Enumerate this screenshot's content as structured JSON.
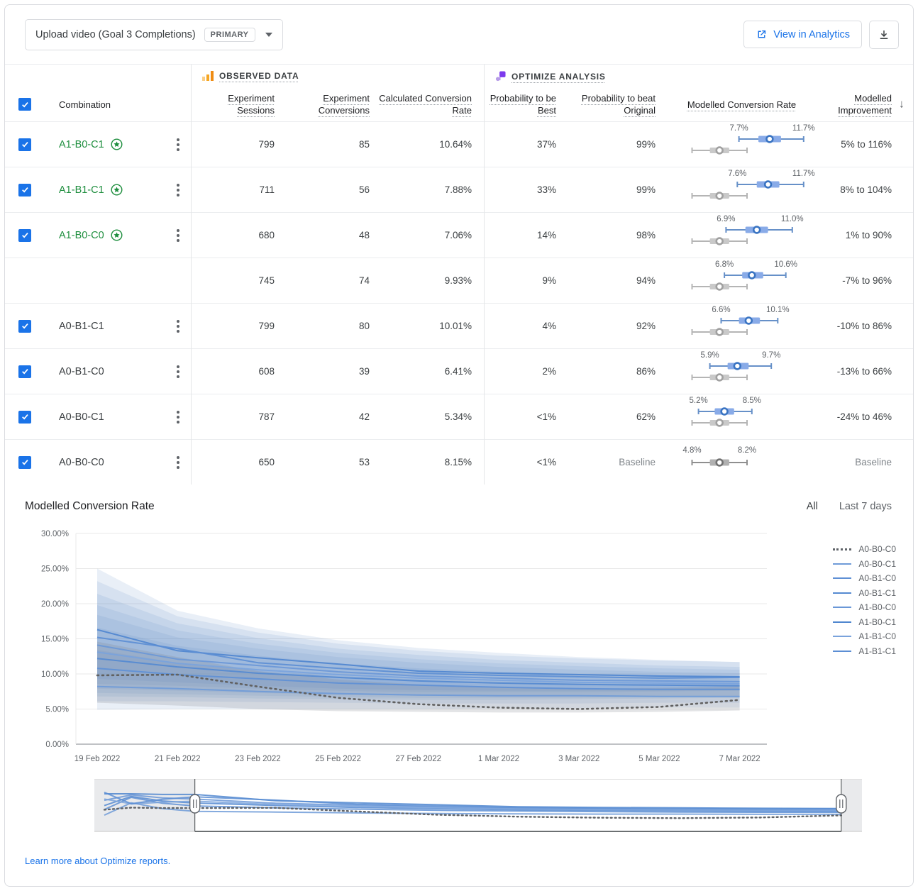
{
  "colors": {
    "accent_blue": "#1a73e8",
    "leader_green": "#1e8e3e",
    "box_blue_whisker": "#6690c8",
    "box_blue_fill": "#89abe8",
    "box_gray_whisker": "#b5b5b5",
    "observed_icon_orange": "#f5a623",
    "optimize_icon_purple": "#7c3aed"
  },
  "toolbar": {
    "goal_selector": {
      "label": "Upload video (Goal 3 Completions)",
      "badge": "PRIMARY"
    },
    "view_in_analytics_label": "View in Analytics"
  },
  "table": {
    "group_observed": "OBSERVED DATA",
    "group_optimize": "OPTIMIZE ANALYSIS",
    "columns": {
      "combination": "Combination",
      "sessions": "Experiment Sessions",
      "conversions": "Experiment Conversions",
      "rate": "Calculated Conversion Rate",
      "prob_best": "Probability to be Best",
      "prob_beat": "Probability to beat Original",
      "modelled_rate": "Modelled Conversion Rate",
      "modelled_improvement": "Modelled Improvement"
    },
    "baseline_box": {
      "min": 4.8,
      "max": 8.2,
      "q1": 5.9,
      "q3": 7.1,
      "median": 6.5,
      "label_min": "4.8%",
      "label_max": "8.2%"
    },
    "rows": [
      {
        "label": "A1-B0-C1",
        "starred": true,
        "checked": true,
        "menu": true,
        "sessions": "799",
        "conversions": "85",
        "rate": "10.64%",
        "prob_best": "37%",
        "prob_beat": "99%",
        "box": {
          "min": 7.7,
          "max": 11.7,
          "q1": 8.9,
          "q3": 10.3,
          "median": 9.6,
          "label_min": "7.7%",
          "label_max": "11.7%"
        },
        "improvement": "5% to 116%",
        "muted_beat": false,
        "muted_improvement": false
      },
      {
        "label": "A1-B1-C1",
        "starred": true,
        "checked": true,
        "menu": true,
        "sessions": "711",
        "conversions": "56",
        "rate": "7.88%",
        "prob_best": "33%",
        "prob_beat": "99%",
        "box": {
          "min": 7.6,
          "max": 11.7,
          "q1": 8.8,
          "q3": 10.2,
          "median": 9.5,
          "label_min": "7.6%",
          "label_max": "11.7%"
        },
        "improvement": "8% to 104%",
        "muted_beat": false,
        "muted_improvement": false
      },
      {
        "label": "A1-B0-C0",
        "starred": true,
        "checked": true,
        "menu": true,
        "sessions": "680",
        "conversions": "48",
        "rate": "7.06%",
        "prob_best": "14%",
        "prob_beat": "98%",
        "box": {
          "min": 6.9,
          "max": 11.0,
          "q1": 8.1,
          "q3": 9.5,
          "median": 8.8,
          "label_min": "6.9%",
          "label_max": "11.0%"
        },
        "improvement": "1% to 90%",
        "muted_beat": false,
        "muted_improvement": false
      },
      {
        "label": "",
        "starred": false,
        "checked": null,
        "menu": false,
        "sessions": "745",
        "conversions": "74",
        "rate": "9.93%",
        "prob_best": "9%",
        "prob_beat": "94%",
        "box": {
          "min": 6.8,
          "max": 10.6,
          "q1": 7.9,
          "q3": 9.2,
          "median": 8.5,
          "label_min": "6.8%",
          "label_max": "10.6%"
        },
        "improvement": "-7% to 96%",
        "muted_beat": false,
        "muted_improvement": false
      },
      {
        "label": "A0-B1-C1",
        "starred": false,
        "checked": true,
        "menu": true,
        "sessions": "799",
        "conversions": "80",
        "rate": "10.01%",
        "prob_best": "4%",
        "prob_beat": "92%",
        "box": {
          "min": 6.6,
          "max": 10.1,
          "q1": 7.7,
          "q3": 9.0,
          "median": 8.3,
          "label_min": "6.6%",
          "label_max": "10.1%"
        },
        "improvement": "-10% to 86%",
        "muted_beat": false,
        "muted_improvement": false
      },
      {
        "label": "A0-B1-C0",
        "starred": false,
        "checked": true,
        "menu": true,
        "sessions": "608",
        "conversions": "39",
        "rate": "6.41%",
        "prob_best": "2%",
        "prob_beat": "86%",
        "box": {
          "min": 5.9,
          "max": 9.7,
          "q1": 7.0,
          "q3": 8.3,
          "median": 7.6,
          "label_min": "5.9%",
          "label_max": "9.7%"
        },
        "improvement": "-13% to 66%",
        "muted_beat": false,
        "muted_improvement": false
      },
      {
        "label": "A0-B0-C1",
        "starred": false,
        "checked": true,
        "menu": true,
        "sessions": "787",
        "conversions": "42",
        "rate": "5.34%",
        "prob_best": "<1%",
        "prob_beat": "62%",
        "box": {
          "min": 5.2,
          "max": 8.5,
          "q1": 6.2,
          "q3": 7.4,
          "median": 6.8,
          "label_min": "5.2%",
          "label_max": "8.5%"
        },
        "improvement": "-24% to 46%",
        "muted_beat": false,
        "muted_improvement": false
      },
      {
        "label": "A0-B0-C0",
        "starred": false,
        "checked": true,
        "menu": true,
        "sessions": "650",
        "conversions": "53",
        "rate": "8.15%",
        "prob_best": "<1%",
        "prob_beat": "Baseline",
        "box": null,
        "improvement": "Baseline",
        "muted_beat": true,
        "muted_improvement": true
      }
    ]
  },
  "chart_data": {
    "type": "line",
    "title": "Modelled Conversion Rate",
    "range_buttons": [
      "All",
      "Last 7 days"
    ],
    "active_range": "All",
    "ylim": [
      0,
      30
    ],
    "y_ticks": [
      "0.00%",
      "5.00%",
      "10.00%",
      "15.00%",
      "20.00%",
      "25.00%",
      "30.00%"
    ],
    "x": [
      "19 Feb 2022",
      "21 Feb 2022",
      "23 Feb 2022",
      "25 Feb 2022",
      "27 Feb 2022",
      "1 Mar 2022",
      "3 Mar 2022",
      "5 Mar 2022",
      "7 Mar 2022"
    ],
    "grid": true,
    "legend_position": "right",
    "series": [
      {
        "name": "A0-B0-C0",
        "style": "dotted",
        "color": "#5f6368",
        "values": [
          9.8,
          9.9,
          8.2,
          6.6,
          5.7,
          5.2,
          5.0,
          5.3,
          6.3
        ],
        "band": {
          "upper": [
            14.6,
            12.4,
            10.4,
            9.2,
            8.5,
            8.1,
            7.9,
            8.0,
            8.2
          ],
          "lower": [
            5.9,
            5.5,
            5.0,
            4.7,
            4.6,
            4.5,
            4.5,
            4.6,
            4.8
          ]
        }
      },
      {
        "name": "A0-B0-C1",
        "style": "solid",
        "color": "#6f9bd8",
        "values": [
          8.2,
          7.9,
          7.5,
          7.2,
          7.0,
          6.9,
          6.9,
          6.8,
          6.8
        ],
        "band": {
          "upper": [
            13.4,
            11.6,
            10.5,
            9.7,
            9.2,
            8.9,
            8.7,
            8.6,
            8.5
          ],
          "lower": [
            4.9,
            5.0,
            5.0,
            5.0,
            5.0,
            5.1,
            5.1,
            5.2,
            5.2
          ]
        }
      },
      {
        "name": "A0-B1-C0",
        "style": "solid",
        "color": "#5f90d5",
        "values": [
          10.8,
          9.9,
          9.3,
          8.7,
          8.4,
          8.1,
          7.9,
          7.8,
          7.8
        ],
        "band": {
          "upper": [
            16.6,
            14.0,
            12.6,
            11.5,
            10.8,
            10.3,
            10.0,
            9.8,
            9.7
          ],
          "lower": [
            6.1,
            6.1,
            6.0,
            5.9,
            5.8,
            5.8,
            5.8,
            5.9,
            5.9
          ]
        }
      },
      {
        "name": "A0-B1-C1",
        "style": "solid",
        "color": "#558ad1",
        "values": [
          12.2,
          11.0,
          10.1,
          9.5,
          9.0,
          8.7,
          8.5,
          8.4,
          8.3
        ],
        "band": {
          "upper": [
            18.4,
            15.2,
            13.6,
            12.4,
            11.6,
            11.0,
            10.6,
            10.3,
            10.1
          ],
          "lower": [
            6.8,
            6.7,
            6.5,
            6.4,
            6.3,
            6.3,
            6.4,
            6.5,
            6.6
          ]
        }
      },
      {
        "name": "A1-B0-C0",
        "style": "solid",
        "color": "#6a97d7",
        "values": [
          14.1,
          12.1,
          11.2,
          10.3,
          9.7,
          9.4,
          9.1,
          9.0,
          8.9
        ],
        "band": {
          "upper": [
            21.4,
            17.2,
            15.1,
            13.6,
            12.7,
            12.0,
            11.6,
            11.2,
            11.0
          ],
          "lower": [
            7.9,
            7.6,
            7.3,
            7.0,
            6.9,
            6.8,
            6.8,
            6.8,
            6.9
          ]
        }
      },
      {
        "name": "A1-B0-C1",
        "style": "solid",
        "color": "#4f86cf",
        "values": [
          16.3,
          13.3,
          12.3,
          11.4,
          10.4,
          10.1,
          9.9,
          9.7,
          9.6
        ],
        "band": {
          "upper": [
            25.0,
            19.0,
            16.5,
            14.8,
            13.7,
            13.0,
            12.4,
            12.0,
            11.7
          ],
          "lower": [
            9.3,
            8.8,
            8.3,
            7.9,
            7.7,
            7.6,
            7.6,
            7.6,
            7.7
          ]
        }
      },
      {
        "name": "A1-B1-C0",
        "style": "solid",
        "color": "#7aa3dc",
        "values": [
          13.1,
          11.5,
          10.6,
          9.9,
          9.4,
          9.1,
          8.8,
          8.7,
          8.6
        ],
        "band": {
          "upper": [
            19.8,
            16.2,
            14.3,
            13.0,
            12.1,
            11.5,
            11.1,
            10.8,
            10.6
          ],
          "lower": [
            7.3,
            7.1,
            6.9,
            6.7,
            6.6,
            6.6,
            6.6,
            6.7,
            6.8
          ]
        }
      },
      {
        "name": "A1-B1-C1",
        "style": "solid",
        "color": "#5c8ed4",
        "values": [
          15.2,
          13.6,
          11.6,
          10.8,
          10.1,
          9.8,
          9.6,
          9.4,
          9.5
        ],
        "band": {
          "upper": [
            23.2,
            18.2,
            15.9,
            14.3,
            13.3,
            12.6,
            12.2,
            11.9,
            11.7
          ],
          "lower": [
            8.6,
            8.3,
            7.9,
            7.6,
            7.4,
            7.4,
            7.4,
            7.5,
            7.6
          ]
        }
      }
    ]
  },
  "brush": {
    "handle_fractions": [
      0.131,
      0.973
    ]
  },
  "footer": {
    "learn_more": "Learn more about Optimize reports."
  }
}
